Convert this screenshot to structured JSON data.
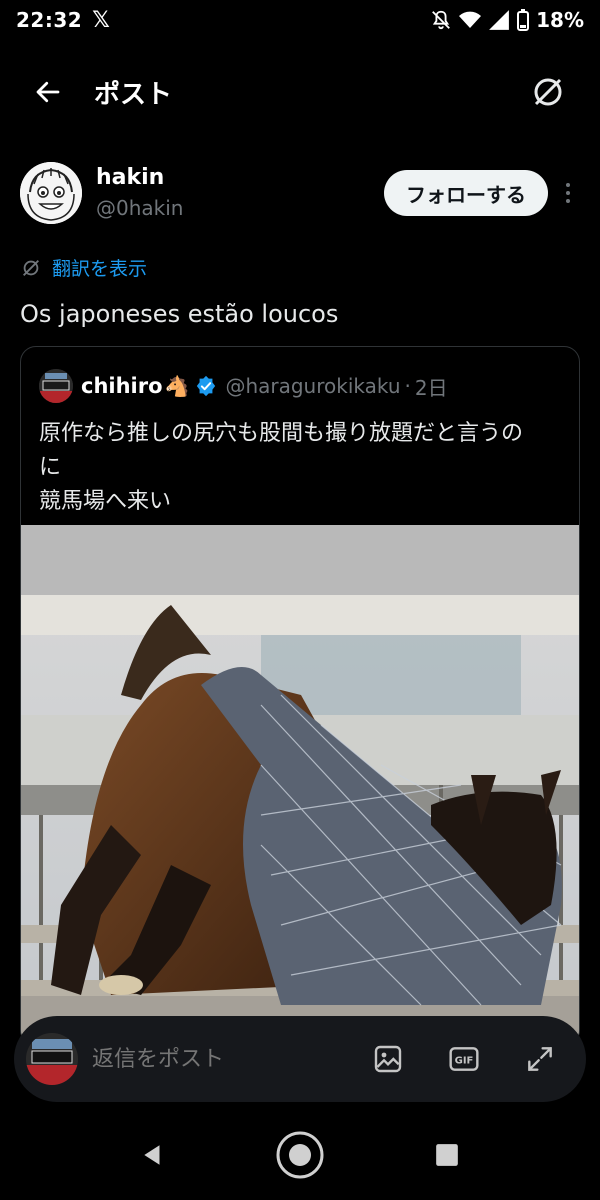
{
  "status_bar": {
    "time": "22:32",
    "battery": "18%"
  },
  "header": {
    "title": "ポスト"
  },
  "author": {
    "name": "hakin",
    "handle": "@0hakin",
    "follow_label": "フォローする"
  },
  "translate_label": "翻訳を表示",
  "post": {
    "text": "Os japoneses estão loucos"
  },
  "quote": {
    "name": "chihiro",
    "horse_emoji": "🐴",
    "handle": "@haragurokikaku",
    "separator": "·",
    "time": "2日",
    "text": "原作なら推しの尻穴も股間も撮り放題だと言うの\nに\n競馬場へ来い"
  },
  "reply": {
    "placeholder": "返信をポスト"
  },
  "colors": {
    "accent": "#1d9bf0",
    "verified": "#1d9bf0",
    "background": "#000000"
  },
  "icons": [
    "back-arrow-icon",
    "translate-icon",
    "verified-badge-icon",
    "image-icon",
    "gif-icon",
    "expand-icon",
    "nav-back-icon",
    "nav-home-icon",
    "nav-recents-icon"
  ]
}
